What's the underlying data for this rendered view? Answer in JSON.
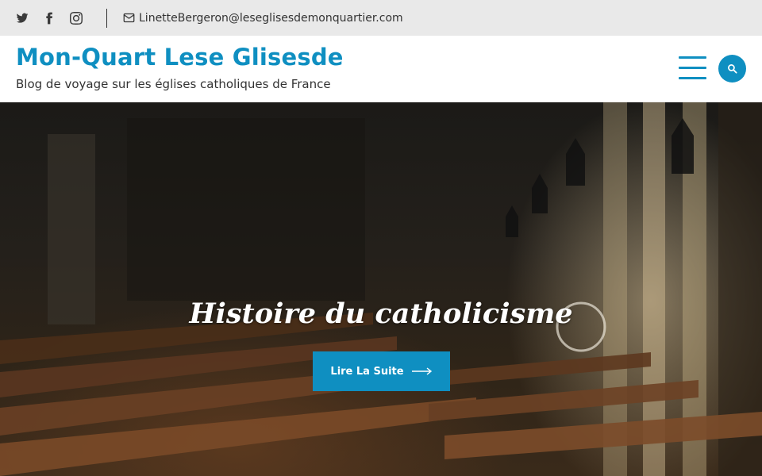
{
  "topbar": {
    "social": [
      {
        "name": "twitter-icon"
      },
      {
        "name": "facebook-icon"
      },
      {
        "name": "instagram-icon"
      }
    ],
    "email": "LinetteBergeron@leseglisesdemonquartier.com",
    "email_icon": "envelope-icon"
  },
  "header": {
    "site_title": "Mon-Quart Lese Glisesde",
    "tagline": "Blog de voyage sur les églises catholiques de France",
    "menu_icon": "hamburger-menu-icon",
    "search_icon": "search-icon"
  },
  "hero": {
    "title": "Histoire du catholicisme",
    "button_label": "Lire La Suite",
    "button_icon": "arrow-right-icon"
  },
  "colors": {
    "accent": "#0f8fc1",
    "topbar_bg": "#e9e9e9",
    "text": "#333333"
  }
}
